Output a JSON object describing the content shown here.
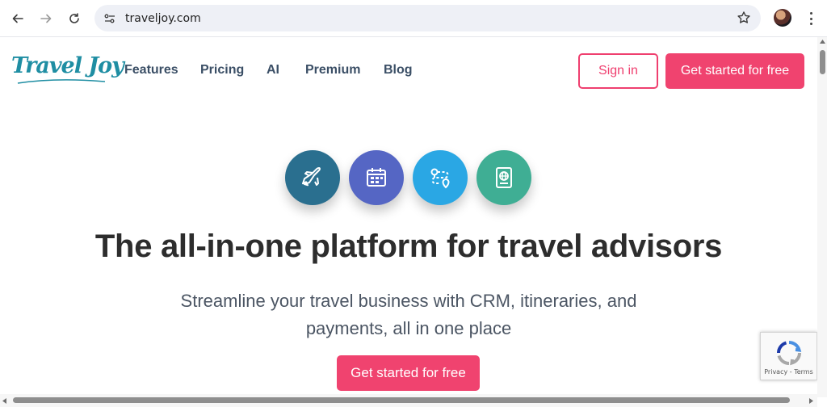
{
  "browser": {
    "url": "traveljoy.com",
    "icons": [
      "back-arrow-icon",
      "forward-arrow-icon",
      "reload-icon",
      "site-info-icon",
      "bookmark-star-icon",
      "profile-avatar",
      "more-menu-icon"
    ]
  },
  "header": {
    "logo_text": "Travel Joy",
    "nav": [
      {
        "label": "Features"
      },
      {
        "label": "Pricing"
      },
      {
        "label": "AI"
      },
      {
        "label": "Premium"
      },
      {
        "label": "Blog"
      }
    ],
    "signin_label": "Sign in",
    "cta_label": "Get started for free"
  },
  "hero": {
    "icons": [
      {
        "name": "airplane-icon",
        "color": "#2a6f8f"
      },
      {
        "name": "calendar-icon",
        "color": "#5566c4"
      },
      {
        "name": "route-map-icon",
        "color": "#2aa7e4"
      },
      {
        "name": "passport-icon",
        "color": "#3fae94"
      }
    ],
    "title": "The all-in-one platform for travel advisors",
    "subtitle": "Streamline your travel business with CRM, itineraries, and payments, all in one place",
    "cta_label": "Get started for free"
  },
  "recaptcha": {
    "links": "Privacy - Terms"
  },
  "colors": {
    "brand_pink": "#f0436f",
    "nav_text": "#3b4f66",
    "logo_teal": "#1f8ea3"
  }
}
